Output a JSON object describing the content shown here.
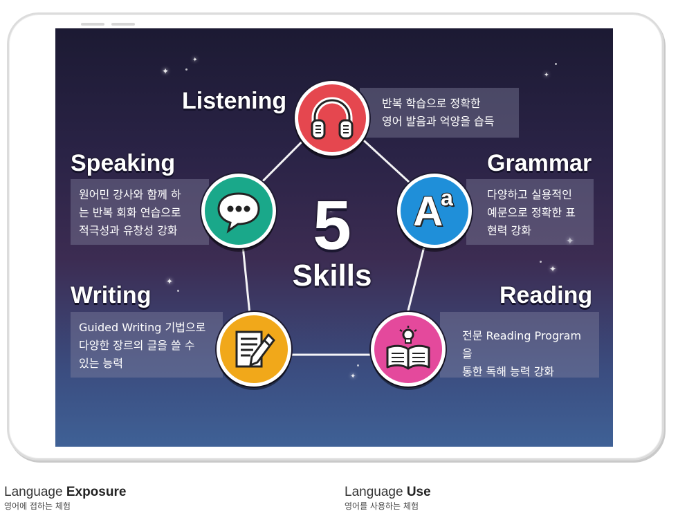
{
  "center": {
    "number": "5",
    "label": "Skills"
  },
  "skills": {
    "listening": {
      "title": "Listening",
      "desc": [
        "반복 학습으로 정확한",
        "영어 발음과 억양을 습득"
      ],
      "color": "#e5474f",
      "icon": "headphones-icon"
    },
    "grammar": {
      "title": "Grammar",
      "desc": [
        "다양하고 실용적인",
        "예문으로 정확한 표",
        "현력 강화"
      ],
      "color": "#1f8fd9",
      "icon": "aa-letters-icon",
      "icon_text": "A",
      "icon_text_small": "a"
    },
    "speaking": {
      "title": "Speaking",
      "desc": [
        "원어민 강사와 함께 하",
        "는 반복 회화 연습으로",
        "적극성과 유창성 강화"
      ],
      "color": "#1aa88a",
      "icon": "speech-bubble-icon"
    },
    "writing": {
      "title": "Writing",
      "desc": [
        "Guided Writing 기법으로",
        "다양한 장르의 글을 쓸 수",
        "있는 능력"
      ],
      "color": "#f1a81a",
      "icon": "document-pencil-icon"
    },
    "reading": {
      "title": "Reading",
      "desc": [
        "전문 Reading Program을",
        "통한 독해 능력 강화"
      ],
      "color": "#e4499c",
      "icon": "open-book-bulb-icon"
    }
  },
  "captions": [
    {
      "main_prefix": "Language ",
      "main_bold": "Exposure",
      "sub": "영어에 접하는 체험"
    },
    {
      "main_prefix": "Language ",
      "main_bold": "Use",
      "sub": "영어를 사용하는 체험"
    }
  ]
}
